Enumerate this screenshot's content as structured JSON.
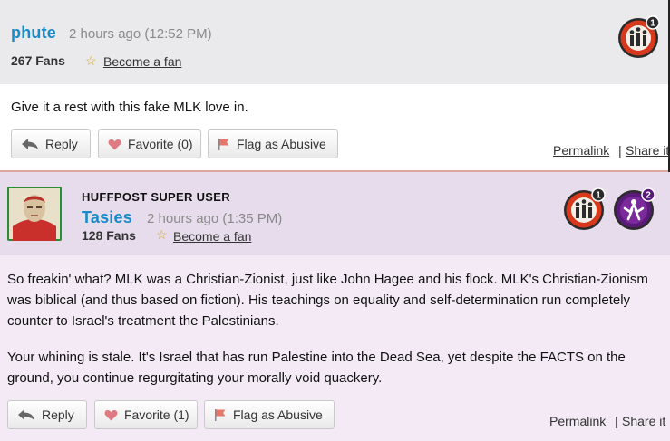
{
  "comments": [
    {
      "username": "phute",
      "timestamp": "2 hours ago (12:52 PM)",
      "fans": "267 Fans",
      "become_fan": "Become a fan",
      "text_paragraphs": [
        "Give it a rest with this fake MLK love in."
      ],
      "actions": {
        "reply": "Reply",
        "favorite": "Favorite (0)",
        "flag": "Flag as Abusive"
      },
      "permalink": "Permalink",
      "share": "Share it",
      "badges": [
        {
          "icon": "networking-badge-icon",
          "level": "1"
        }
      ]
    },
    {
      "user_title": "HUFFPOST SUPER USER",
      "username": "Tasies",
      "timestamp": "2 hours ago (1:35 PM)",
      "fans": "128 Fans",
      "become_fan": "Become a fan",
      "text_paragraphs": [
        "So freakin' what? MLK was a Christian-Zionist, just like John Hagee and his flock. MLK's Christian-Zionism was biblical (and thus based on fiction). His teachings on equality and self-determination run completely counter to Israel's treatment the Palestinians.",
        "Your whining is stale. It's Israel that has run Palestine into the Dead Sea, yet despite the FACTS on the ground, you continue regurgitating your morally void quackery."
      ],
      "actions": {
        "reply": "Reply",
        "favorite": "Favorite (1)",
        "flag": "Flag as Abusive"
      },
      "permalink": "Permalink",
      "share": "Share it",
      "badges": [
        {
          "icon": "networking-badge-icon",
          "level": "1"
        },
        {
          "icon": "superuser-badge-icon",
          "level": "2"
        }
      ]
    }
  ],
  "colors": {
    "username": "#1a8bc7",
    "header_bg_1": "#eae9ec",
    "header_bg_2": "#e7dcec",
    "body_bg_2": "#f3eaf6",
    "networking_badge": "#d8381c",
    "superuser_badge": "#5a1a7a"
  }
}
